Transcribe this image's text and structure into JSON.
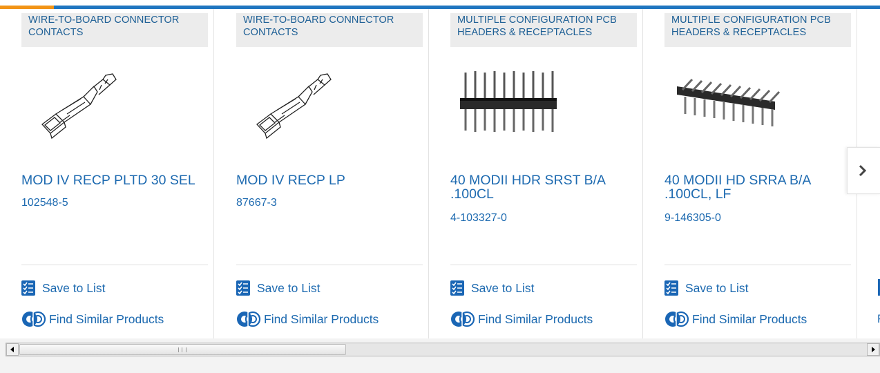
{
  "navigation": {
    "next_icon": "chevron-right"
  },
  "products": [
    {
      "category": "WIRE-TO-BOARD CONNECTOR CONTACTS",
      "name": "MOD IV RECP PLTD 30 SEL",
      "part_number": "102548-5",
      "save_label": "Save to List",
      "find_label": "Find Similar Products",
      "image_icon": "crimp-contact"
    },
    {
      "category": "WIRE-TO-BOARD CONNECTOR CONTACTS",
      "name": "MOD IV RECP LP",
      "part_number": "87667-3",
      "save_label": "Save to List",
      "find_label": "Find Similar Products",
      "image_icon": "crimp-contact"
    },
    {
      "category": "MULTIPLE CONFIGURATION PCB HEADERS & RECEPTACLES",
      "name": "40 MODII HDR SRST B/A .100CL",
      "part_number": "4-103327-0",
      "save_label": "Save to List",
      "find_label": "Find Similar Products",
      "image_icon": "straight-pin-header"
    },
    {
      "category": "MULTIPLE CONFIGURATION PCB HEADERS & RECEPTACLES",
      "name": "40 MODII HD SRRA B/A .100CL, LF",
      "part_number": "9-146305-0",
      "save_label": "Save to List",
      "find_label": "Find Similar Products",
      "image_icon": "right-angle-header"
    }
  ],
  "peek": {
    "text": "F"
  },
  "colors": {
    "accent": "#1f76c0",
    "highlight": "#f29417",
    "link": "#1d6ab0"
  }
}
